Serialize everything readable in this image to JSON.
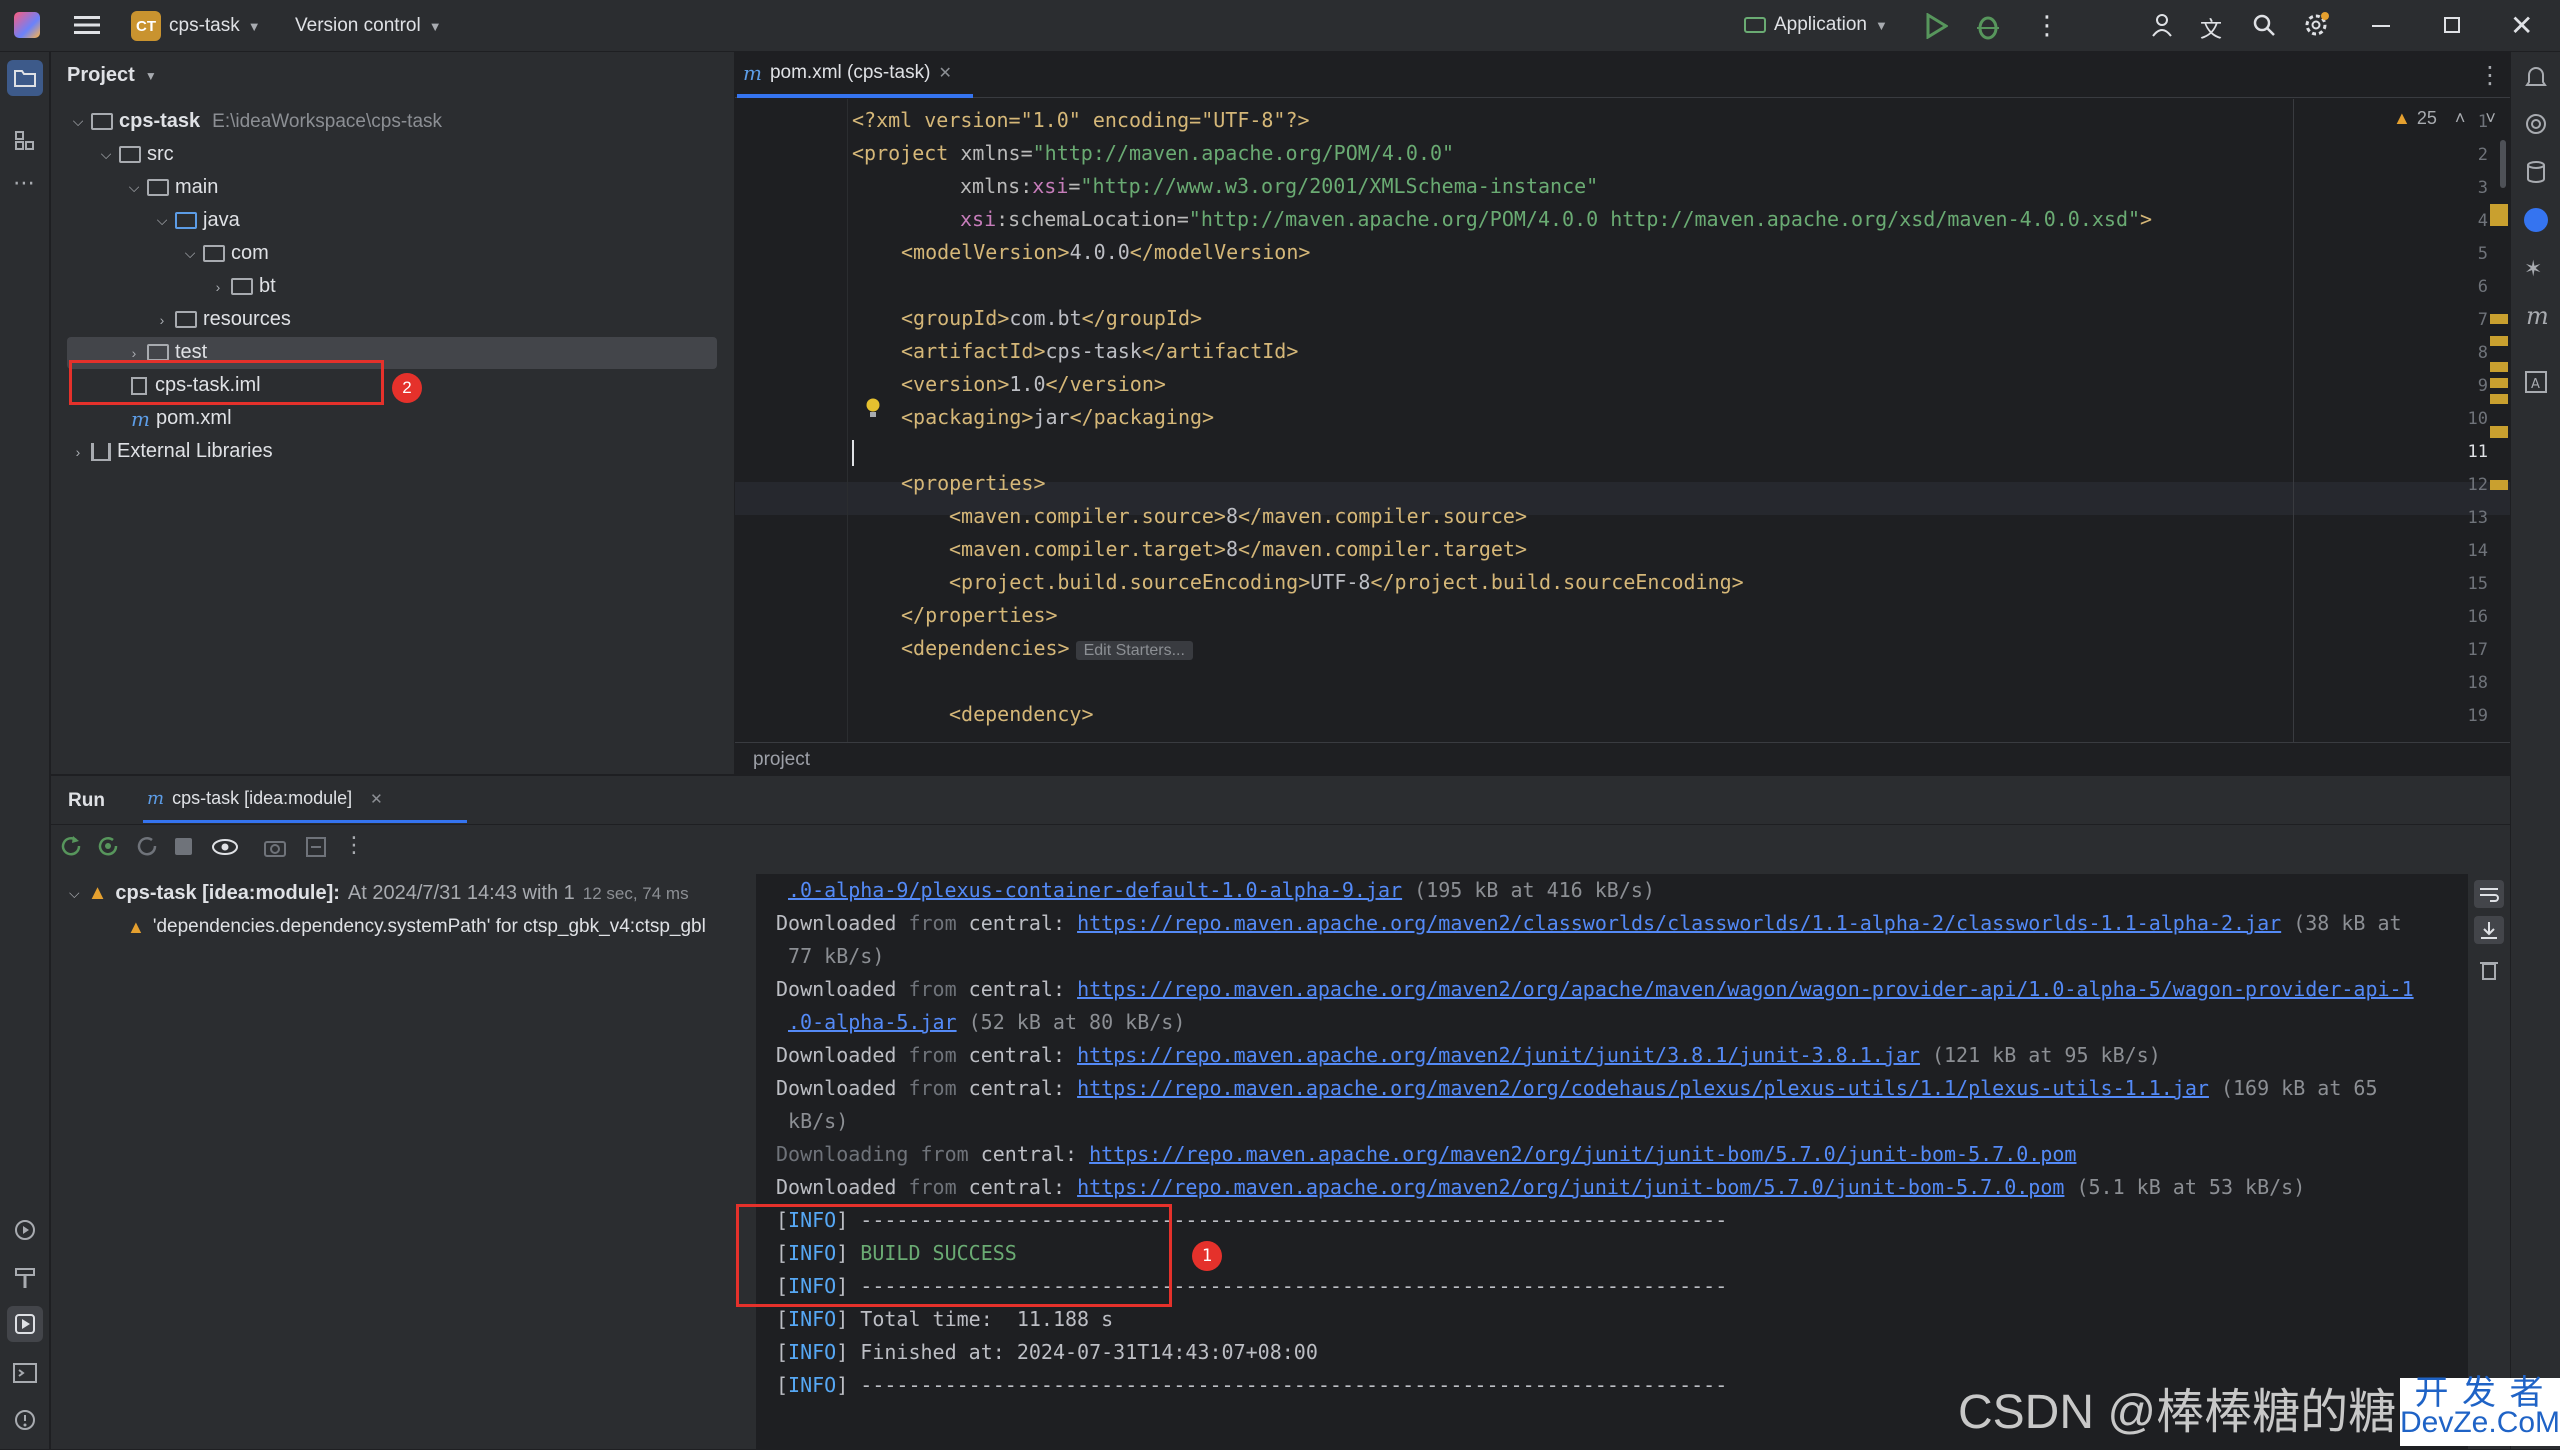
{
  "titlebar": {
    "project_badge": "CT",
    "project_name": "cps-task",
    "vcs": "Version control",
    "run_config": "Application"
  },
  "project_panel": {
    "title": "Project",
    "tree": [
      {
        "label": "cps-task",
        "path": "E:\\ideaWorkspace\\cps-task"
      },
      {
        "label": "src"
      },
      {
        "label": "main"
      },
      {
        "label": "java"
      },
      {
        "label": "com"
      },
      {
        "label": "bt"
      },
      {
        "label": "resources"
      },
      {
        "label": "test"
      },
      {
        "label": "cps-task.iml"
      },
      {
        "label": "pom.xml"
      },
      {
        "label": "External Libraries"
      }
    ],
    "annotation": "2"
  },
  "editor": {
    "tab": "pom.xml (cps-task)",
    "warning_count": "25",
    "breadcrumb": "project",
    "edit_starters": "Edit Starters...",
    "line_numbers": [
      "1",
      "2",
      "3",
      "4",
      "5",
      "6",
      "7",
      "8",
      "9",
      "10",
      "11",
      "12",
      "13",
      "14",
      "15",
      "16",
      "17",
      "18",
      "19"
    ],
    "lines": {
      "l1": "<?xml version=\"1.0\" encoding=\"UTF-8\"?>",
      "l2a": "<project ",
      "l2b": "xmlns=",
      "l2c": "\"http://maven.apache.org/POM/4.0.0\"",
      "l3a": "xmlns:",
      "l3b": "xsi",
      "l3c": "=",
      "l3d": "\"http://www.w3.org/2001/XMLSchema-instance\"",
      "l4a": "xsi",
      "l4b": ":schemaLocation=",
      "l4c": "\"http://maven.apache.org/POM/4.0.0 http://maven.apache.org/xsd/maven-4.0.0.xsd\"",
      "l4d": ">",
      "l5a": "<modelVersion>",
      "l5b": "4.0.0",
      "l5c": "</modelVersion>",
      "l7a": "<groupId>",
      "l7b": "com.bt",
      "l7c": "</groupId>",
      "l8a": "<artifactId>",
      "l8b": "cps-task",
      "l8c": "</artifactId>",
      "l9a": "<version>",
      "l9b": "1.0",
      "l9c": "</version>",
      "l10a": "<packaging>",
      "l10b": "jar",
      "l10c": "</packaging>",
      "l12": "<properties>",
      "l13a": "<maven.compiler.source>",
      "l13b": "8",
      "l13c": "</maven.compiler.source>",
      "l14a": "<maven.compiler.target>",
      "l14b": "8",
      "l14c": "</maven.compiler.target>",
      "l15a": "<project.build.sourceEncoding>",
      "l15b": "UTF-8",
      "l15c": "</project.build.sourceEncoding>",
      "l16": "</properties>",
      "l17": "<dependencies>",
      "l19": "<dependency>"
    }
  },
  "run_panel": {
    "tab_run": "Run",
    "tab_module": "cps-task [idea:module]",
    "tree_root": "cps-task [idea:module]:",
    "tree_root_time": "At 2024/7/31 14:43 with 1",
    "tree_root_duration": "12 sec, 74 ms",
    "tree_warning": "'dependencies.dependency.systemPath' for ctsp_gbk_v4:ctsp_gbl",
    "annotation": "1",
    "console": {
      "c1a": ".0-alpha-9/plexus-container-default-1.0-alpha-9.jar",
      "c1b": " (195 kB at 416 kB/s)",
      "downloaded": "Downloaded",
      "downloading": "Downloading",
      "from": " from ",
      "central": "central",
      "c2": "https://repo.maven.apache.org/maven2/classworlds/classworlds/1.1-alpha-2/classworlds-1.1-alpha-2.jar",
      "c2b": " (38 kB at",
      "c3": " 77 kB/s)",
      "c4": "https://repo.maven.apache.org/maven2/org/apache/maven/wagon/wagon-provider-api/1.0-alpha-5/wagon-provider-api-1",
      "c5a": ".0-alpha-5.jar",
      "c5b": " (52 kB at 80 kB/s)",
      "c6": "https://repo.maven.apache.org/maven2/junit/junit/3.8.1/junit-3.8.1.jar",
      "c6b": " (121 kB at 95 kB/s)",
      "c7": "https://repo.maven.apache.org/maven2/org/codehaus/plexus/plexus-utils/1.1/plexus-utils-1.1.jar",
      "c7b": " (169 kB at 65",
      "c8": " kB/s)",
      "c9": "https://repo.maven.apache.org/maven2/org/junit/junit-bom/5.7.0/junit-bom-5.7.0.pom",
      "c10": "https://repo.maven.apache.org/maven2/org/junit/junit-bom/5.7.0/junit-bom-5.7.0.pom",
      "c10b": " (5.1 kB at 53 kB/s)",
      "info": "INFO",
      "sep": " ------------------------------------------------------------------------",
      "build": " BUILD SUCCESS",
      "total": " Total time:  11.188 s",
      "finished": " Finished at: 2024-07-31T14:43:07+08:00"
    }
  },
  "watermark": {
    "csdn": "CSDN @棒棒糖的糖",
    "devze_top": "开 发 者",
    "devze_bottom": "DevZe.CoM"
  }
}
